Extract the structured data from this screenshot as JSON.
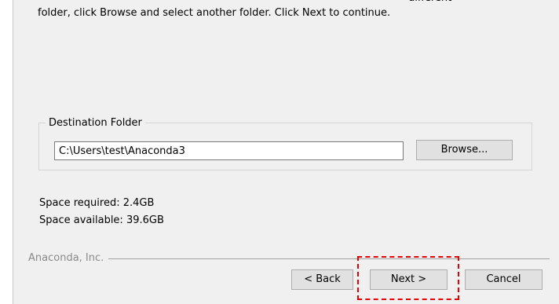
{
  "description": {
    "line_partial": "different",
    "line_2": "folder, click Browse and select another folder. Click Next to continue."
  },
  "destination": {
    "group_label": "Destination Folder",
    "path_value": "C:\\Users\\test\\Anaconda3",
    "browse_label": "Browse..."
  },
  "space": {
    "required": "Space required: 2.4GB",
    "available": "Space available: 39.6GB"
  },
  "footer": {
    "brand": "Anaconda, Inc.",
    "back_label": "< Back",
    "next_label": "Next >",
    "cancel_label": "Cancel"
  },
  "colors": {
    "highlight": "#e60000",
    "background": "#f0f0f0"
  }
}
